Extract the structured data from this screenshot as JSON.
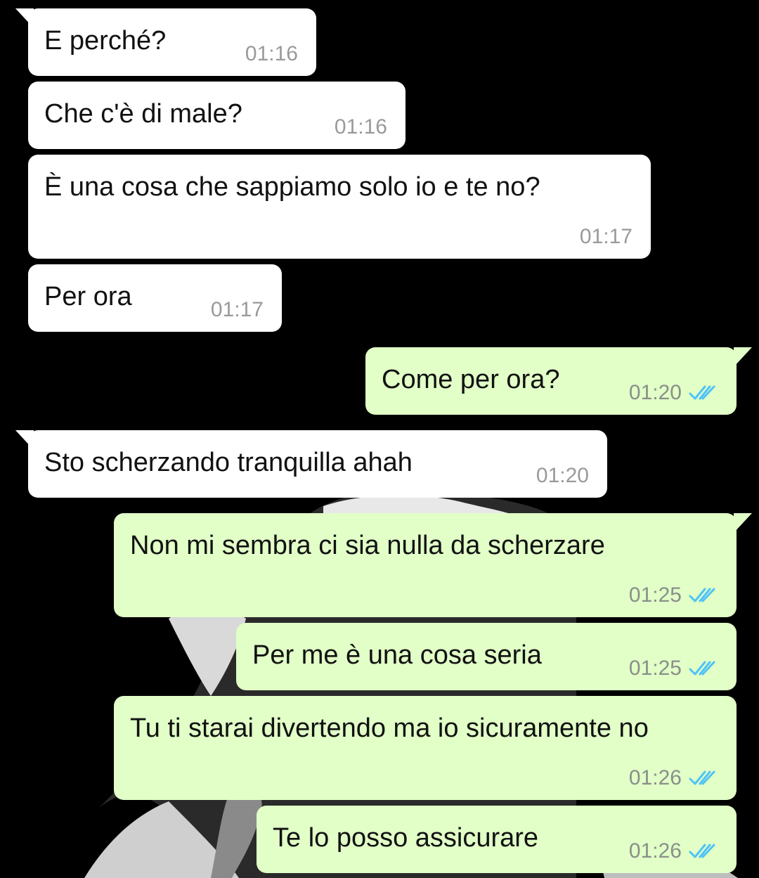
{
  "messages": [
    {
      "text": "E perché?",
      "time": "01:16",
      "dir": "in"
    },
    {
      "text": "Che c'è di male?",
      "time": "01:16",
      "dir": "in"
    },
    {
      "text": "È una cosa che sappiamo solo io e te no?",
      "time": "01:17",
      "dir": "in"
    },
    {
      "text": "Per ora",
      "time": "01:17",
      "dir": "in"
    },
    {
      "text": "Come per ora?",
      "time": "01:20",
      "dir": "out",
      "status": "read"
    },
    {
      "text": "Sto scherzando tranquilla ahah",
      "time": "01:20",
      "dir": "in"
    },
    {
      "text": "Non mi sembra ci sia nulla da scherzare",
      "time": "01:25",
      "dir": "out",
      "status": "read"
    },
    {
      "text": "Per me è una cosa seria",
      "time": "01:25",
      "dir": "out",
      "status": "read"
    },
    {
      "text": "Tu ti starai divertendo ma io sicuramente no",
      "time": "01:26",
      "dir": "out",
      "status": "read"
    },
    {
      "text": "Te lo posso assicurare",
      "time": "01:26",
      "dir": "out",
      "status": "read"
    }
  ],
  "colors": {
    "background": "#000000",
    "incoming_bubble": "#ffffff",
    "outgoing_bubble": "#e1ffc7",
    "read_ticks": "#4fc3f7"
  }
}
